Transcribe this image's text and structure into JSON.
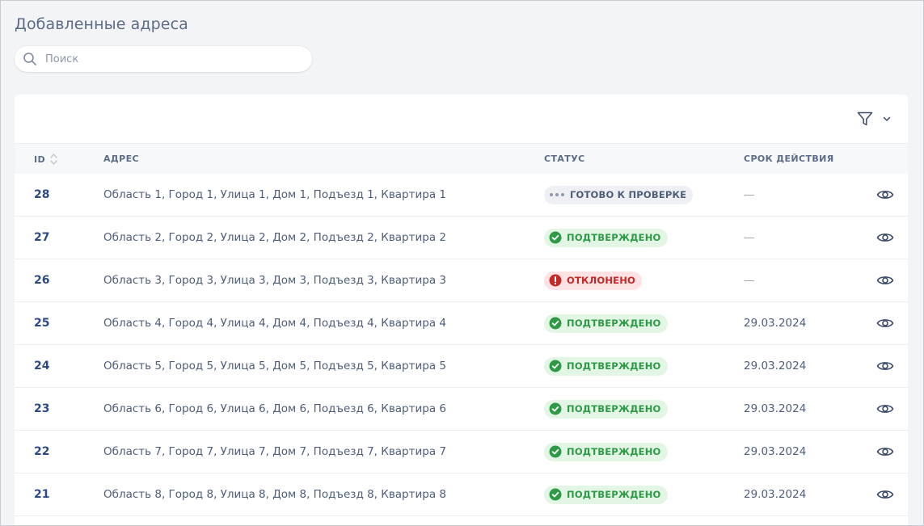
{
  "page": {
    "title": "Добавленные адреса"
  },
  "search": {
    "placeholder": "Поиск"
  },
  "table": {
    "columns": {
      "id": "ID",
      "address": "АДРЕС",
      "status": "СТАТУС",
      "expiry": "СРОК ДЕЙСТВИЯ"
    },
    "rows": [
      {
        "id": "28",
        "address": "Область 1, Город 1, Улица 1, Дом 1, Подъезд 1, Квартира 1",
        "status": "ГОТОВО К ПРОВЕРКЕ",
        "status_kind": "pending",
        "expiry": "—"
      },
      {
        "id": "27",
        "address": "Область 2, Город 2, Улица 2, Дом 2, Подъезд 2, Квартира 2",
        "status": "ПОДТВЕРЖДЕНО",
        "status_kind": "ok",
        "expiry": "—"
      },
      {
        "id": "26",
        "address": "Область 3, Город 3, Улица 3, Дом 3, Подъезд 3, Квартира 3",
        "status": "ОТКЛОНЕНО",
        "status_kind": "rejected",
        "expiry": "—"
      },
      {
        "id": "25",
        "address": "Область 4, Город 4, Улица 4, Дом 4, Подъезд 4, Квартира 4",
        "status": "ПОДТВЕРЖДЕНО",
        "status_kind": "ok",
        "expiry": "29.03.2024"
      },
      {
        "id": "24",
        "address": "Область 5, Город 5, Улица 5, Дом 5, Подъезд 5, Квартира 5",
        "status": "ПОДТВЕРЖДЕНО",
        "status_kind": "ok",
        "expiry": "29.03.2024"
      },
      {
        "id": "23",
        "address": "Область 6, Город 6, Улица 6, Дом 6, Подъезд 6, Квартира 6",
        "status": "ПОДТВЕРЖДЕНО",
        "status_kind": "ok",
        "expiry": "29.03.2024"
      },
      {
        "id": "22",
        "address": "Область 7, Город 7, Улица 7, Дом 7, Подъезд 7, Квартира 7",
        "status": "ПОДТВЕРЖДЕНО",
        "status_kind": "ok",
        "expiry": "29.03.2024"
      },
      {
        "id": "21",
        "address": "Область 8, Город 8, Улица 8, Дом 8, Подъезд 8, Квартира 8",
        "status": "ПОДТВЕРЖДЕНО",
        "status_kind": "ok",
        "expiry": "29.03.2024"
      }
    ]
  },
  "icons": {
    "search": "search-icon",
    "filter": "filter-icon",
    "chevron": "chevron-down-icon",
    "sort": "sort-icon",
    "view": "eye-icon",
    "pending": "dots-icon",
    "ok": "check-circle-icon",
    "rejected": "exclamation-circle-icon"
  },
  "colors": {
    "ok_bg": "#e3f6e6",
    "ok_fg": "#2e9a45",
    "rejected_bg": "#fde3e3",
    "rejected_fg": "#c62828",
    "pending_bg": "#eef0f4",
    "pending_fg": "#4e5d78",
    "id_link": "#2b4a86"
  }
}
